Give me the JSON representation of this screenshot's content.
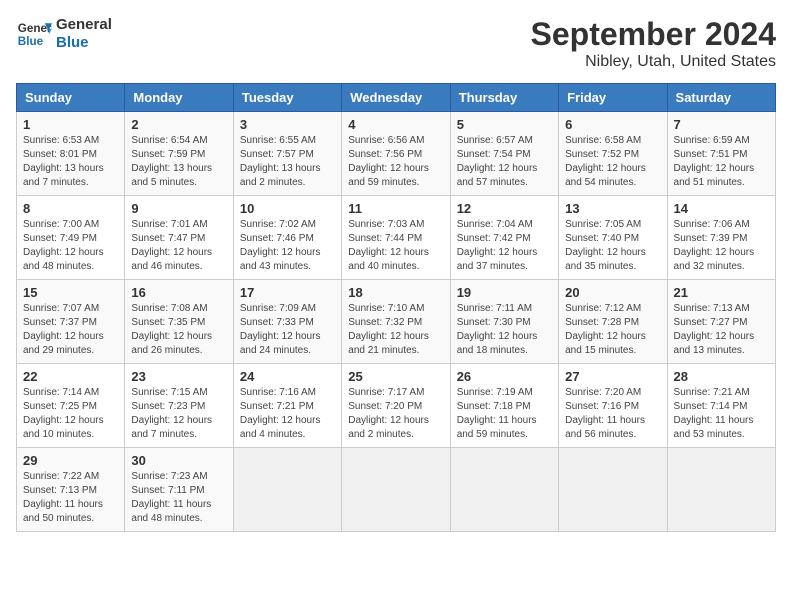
{
  "header": {
    "logo_line1": "General",
    "logo_line2": "Blue",
    "title": "September 2024",
    "subtitle": "Nibley, Utah, United States"
  },
  "days_of_week": [
    "Sunday",
    "Monday",
    "Tuesday",
    "Wednesday",
    "Thursday",
    "Friday",
    "Saturday"
  ],
  "weeks": [
    [
      {
        "day": "1",
        "info": "Sunrise: 6:53 AM\nSunset: 8:01 PM\nDaylight: 13 hours and 7 minutes."
      },
      {
        "day": "2",
        "info": "Sunrise: 6:54 AM\nSunset: 7:59 PM\nDaylight: 13 hours and 5 minutes."
      },
      {
        "day": "3",
        "info": "Sunrise: 6:55 AM\nSunset: 7:57 PM\nDaylight: 13 hours and 2 minutes."
      },
      {
        "day": "4",
        "info": "Sunrise: 6:56 AM\nSunset: 7:56 PM\nDaylight: 12 hours and 59 minutes."
      },
      {
        "day": "5",
        "info": "Sunrise: 6:57 AM\nSunset: 7:54 PM\nDaylight: 12 hours and 57 minutes."
      },
      {
        "day": "6",
        "info": "Sunrise: 6:58 AM\nSunset: 7:52 PM\nDaylight: 12 hours and 54 minutes."
      },
      {
        "day": "7",
        "info": "Sunrise: 6:59 AM\nSunset: 7:51 PM\nDaylight: 12 hours and 51 minutes."
      }
    ],
    [
      {
        "day": "8",
        "info": "Sunrise: 7:00 AM\nSunset: 7:49 PM\nDaylight: 12 hours and 48 minutes."
      },
      {
        "day": "9",
        "info": "Sunrise: 7:01 AM\nSunset: 7:47 PM\nDaylight: 12 hours and 46 minutes."
      },
      {
        "day": "10",
        "info": "Sunrise: 7:02 AM\nSunset: 7:46 PM\nDaylight: 12 hours and 43 minutes."
      },
      {
        "day": "11",
        "info": "Sunrise: 7:03 AM\nSunset: 7:44 PM\nDaylight: 12 hours and 40 minutes."
      },
      {
        "day": "12",
        "info": "Sunrise: 7:04 AM\nSunset: 7:42 PM\nDaylight: 12 hours and 37 minutes."
      },
      {
        "day": "13",
        "info": "Sunrise: 7:05 AM\nSunset: 7:40 PM\nDaylight: 12 hours and 35 minutes."
      },
      {
        "day": "14",
        "info": "Sunrise: 7:06 AM\nSunset: 7:39 PM\nDaylight: 12 hours and 32 minutes."
      }
    ],
    [
      {
        "day": "15",
        "info": "Sunrise: 7:07 AM\nSunset: 7:37 PM\nDaylight: 12 hours and 29 minutes."
      },
      {
        "day": "16",
        "info": "Sunrise: 7:08 AM\nSunset: 7:35 PM\nDaylight: 12 hours and 26 minutes."
      },
      {
        "day": "17",
        "info": "Sunrise: 7:09 AM\nSunset: 7:33 PM\nDaylight: 12 hours and 24 minutes."
      },
      {
        "day": "18",
        "info": "Sunrise: 7:10 AM\nSunset: 7:32 PM\nDaylight: 12 hours and 21 minutes."
      },
      {
        "day": "19",
        "info": "Sunrise: 7:11 AM\nSunset: 7:30 PM\nDaylight: 12 hours and 18 minutes."
      },
      {
        "day": "20",
        "info": "Sunrise: 7:12 AM\nSunset: 7:28 PM\nDaylight: 12 hours and 15 minutes."
      },
      {
        "day": "21",
        "info": "Sunrise: 7:13 AM\nSunset: 7:27 PM\nDaylight: 12 hours and 13 minutes."
      }
    ],
    [
      {
        "day": "22",
        "info": "Sunrise: 7:14 AM\nSunset: 7:25 PM\nDaylight: 12 hours and 10 minutes."
      },
      {
        "day": "23",
        "info": "Sunrise: 7:15 AM\nSunset: 7:23 PM\nDaylight: 12 hours and 7 minutes."
      },
      {
        "day": "24",
        "info": "Sunrise: 7:16 AM\nSunset: 7:21 PM\nDaylight: 12 hours and 4 minutes."
      },
      {
        "day": "25",
        "info": "Sunrise: 7:17 AM\nSunset: 7:20 PM\nDaylight: 12 hours and 2 minutes."
      },
      {
        "day": "26",
        "info": "Sunrise: 7:19 AM\nSunset: 7:18 PM\nDaylight: 11 hours and 59 minutes."
      },
      {
        "day": "27",
        "info": "Sunrise: 7:20 AM\nSunset: 7:16 PM\nDaylight: 11 hours and 56 minutes."
      },
      {
        "day": "28",
        "info": "Sunrise: 7:21 AM\nSunset: 7:14 PM\nDaylight: 11 hours and 53 minutes."
      }
    ],
    [
      {
        "day": "29",
        "info": "Sunrise: 7:22 AM\nSunset: 7:13 PM\nDaylight: 11 hours and 50 minutes."
      },
      {
        "day": "30",
        "info": "Sunrise: 7:23 AM\nSunset: 7:11 PM\nDaylight: 11 hours and 48 minutes."
      },
      {
        "day": "",
        "info": ""
      },
      {
        "day": "",
        "info": ""
      },
      {
        "day": "",
        "info": ""
      },
      {
        "day": "",
        "info": ""
      },
      {
        "day": "",
        "info": ""
      }
    ]
  ]
}
